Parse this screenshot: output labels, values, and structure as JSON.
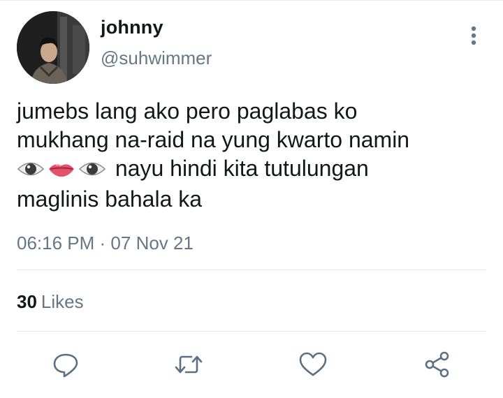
{
  "tweet": {
    "display_name": "johnny",
    "handle": "@suhwimmer",
    "text_lines": [
      "jumebs lang ako pero paglabas ko",
      "mukhang na-raid na yung kwarto namin",
      "nayu hindi kita tutulungan",
      "maglinis bahala ka"
    ],
    "emojis": [
      "eye",
      "mouth",
      "eye"
    ],
    "time": "06:16 PM",
    "date": "07 Nov 21",
    "likes_count": "30",
    "likes_label": "Likes"
  },
  "actions": [
    "reply-icon",
    "retweet-icon",
    "like-icon",
    "share-icon"
  ],
  "colors": {
    "text": "#14171a",
    "secondary": "#657786",
    "divider": "#e1e8ed",
    "icon": "#5b7083"
  }
}
